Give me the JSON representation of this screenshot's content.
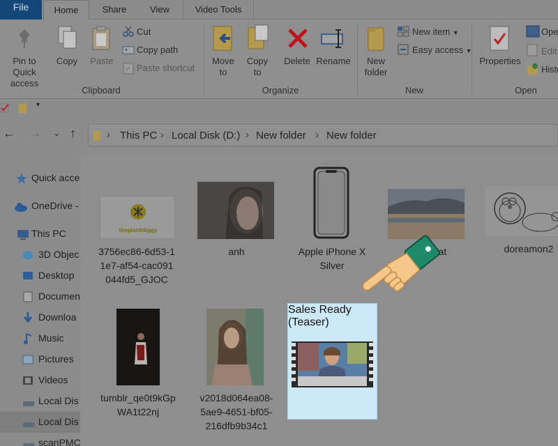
{
  "tabs": {
    "file": "File",
    "home": "Home",
    "share": "Share",
    "view": "View",
    "video_tools": "Video Tools"
  },
  "ribbon": {
    "pin_line1": "Pin to Quick",
    "pin_line2": "access",
    "copy": "Copy",
    "paste": "Paste",
    "cut": "Cut",
    "copy_path": "Copy path",
    "paste_shortcut": "Paste shortcut",
    "clipboard_group": "Clipboard",
    "move_to_line1": "Move",
    "move_to_line2": "to",
    "copy_to_line1": "Copy",
    "copy_to_line2": "to",
    "delete": "Delete",
    "rename": "Rename",
    "organize_group": "Organize",
    "new_folder_line1": "New",
    "new_folder_line2": "folder",
    "new_item": "New item",
    "easy_access": "Easy access",
    "new_group": "New",
    "properties": "Properties",
    "open_partial": "Ope",
    "edit_partial": "Edit",
    "history_partial": "Histo",
    "open_group": "Open"
  },
  "address": {
    "crumbs": [
      "This PC",
      "Local Disk (D:)",
      "New folder",
      "New folder"
    ]
  },
  "nav": {
    "items": [
      {
        "label": "Quick acce",
        "icon": "star-icon"
      },
      {
        "label": "OneDrive -",
        "icon": "cloud-icon"
      },
      {
        "label": "This PC",
        "icon": "computer-icon"
      },
      {
        "label": "3D Objec",
        "icon": "cube-icon"
      },
      {
        "label": "Desktop",
        "icon": "desktop-icon"
      },
      {
        "label": "Documen",
        "icon": "document-icon"
      },
      {
        "label": "Downloa",
        "icon": "download-icon"
      },
      {
        "label": "Music",
        "icon": "music-icon"
      },
      {
        "label": "Pictures",
        "icon": "pictures-icon"
      },
      {
        "label": "Videos",
        "icon": "videos-icon"
      },
      {
        "label": "Local Dis",
        "icon": "drive-icon"
      },
      {
        "label": "Local Dis",
        "icon": "drive-icon"
      },
      {
        "label": "scanPMC",
        "icon": "drive-icon"
      }
    ]
  },
  "files": [
    {
      "name_lines": [
        "3756ec86-6d53-1",
        "1e7-af54-cac091",
        "044fd5_GJOC"
      ],
      "logo_text": "theplantidiggy"
    },
    {
      "name_lines": [
        "anh"
      ]
    },
    {
      "name_lines": [
        "Apple iPhone X",
        "Silver"
      ]
    },
    {
      "name_lines": [
        "...lat"
      ]
    },
    {
      "name_lines": [
        "doreamon2"
      ]
    },
    {
      "name_lines": [
        "tumblr_qe0t9kGp",
        "WA1t22nj"
      ]
    },
    {
      "name_lines": [
        "v2018d064ea08-",
        "5ae9-4651-bf05-",
        "216dfb9b34c1"
      ]
    },
    {
      "name_lines": [
        "Sales Ready",
        "(Teaser)"
      ]
    }
  ],
  "colors": {
    "file_tab": "#14467a",
    "selection": "#cde8f6",
    "delete_red": "#c0141c"
  }
}
